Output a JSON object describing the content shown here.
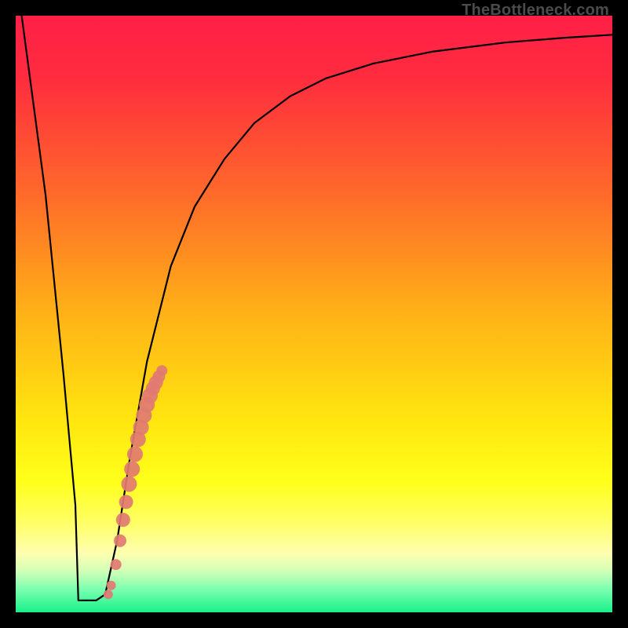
{
  "watermark": {
    "text": "TheBottleneck.com"
  },
  "colors": {
    "frame": "#000000",
    "curve": "#000000",
    "dot_fill": "#e17a72",
    "gradient_stops": [
      {
        "offset": 0.0,
        "color": "#ff1f47"
      },
      {
        "offset": 0.1,
        "color": "#ff2b3f"
      },
      {
        "offset": 0.3,
        "color": "#ff6a2a"
      },
      {
        "offset": 0.5,
        "color": "#ffb217"
      },
      {
        "offset": 0.68,
        "color": "#ffe60f"
      },
      {
        "offset": 0.78,
        "color": "#ffff1a"
      },
      {
        "offset": 0.85,
        "color": "#ffff66"
      },
      {
        "offset": 0.9,
        "color": "#ffffb0"
      },
      {
        "offset": 0.93,
        "color": "#d4ffb8"
      },
      {
        "offset": 0.96,
        "color": "#7fffb0"
      },
      {
        "offset": 1.0,
        "color": "#18f08a"
      }
    ]
  },
  "chart_data": {
    "type": "line",
    "title": "",
    "xlabel": "",
    "ylabel": "",
    "xlim": [
      0,
      100
    ],
    "ylim": [
      0,
      100
    ],
    "curve": {
      "x": [
        1,
        5,
        8,
        10,
        12,
        13.5,
        15,
        17,
        19,
        22,
        26,
        30,
        35,
        40,
        46,
        52,
        60,
        70,
        82,
        92,
        100
      ],
      "y": [
        100,
        70,
        40,
        18,
        4,
        2,
        3,
        12,
        25,
        42,
        58,
        68,
        76,
        82,
        86.5,
        89.5,
        92,
        94,
        95.5,
        96.3,
        96.8
      ]
    },
    "flat_min": {
      "x_from": 10.5,
      "x_to": 13.5,
      "y": 2
    },
    "dots": {
      "x": [
        15.5,
        16.0,
        16.8,
        17.5,
        18.0,
        18.5,
        19.0,
        19.5,
        20.0,
        20.5,
        21.0,
        21.5,
        22.0,
        22.5,
        23.0,
        23.5,
        24.0,
        24.5
      ],
      "y": [
        3.0,
        4.5,
        8.0,
        12.0,
        15.5,
        18.5,
        21.5,
        24.0,
        26.5,
        29.0,
        31.0,
        33.0,
        34.8,
        36.3,
        37.5,
        38.5,
        39.5,
        40.5
      ],
      "r": [
        6,
        6,
        7,
        8,
        9,
        9,
        10,
        10,
        10,
        10,
        10,
        10,
        10,
        10,
        9,
        9,
        8,
        7
      ]
    }
  }
}
